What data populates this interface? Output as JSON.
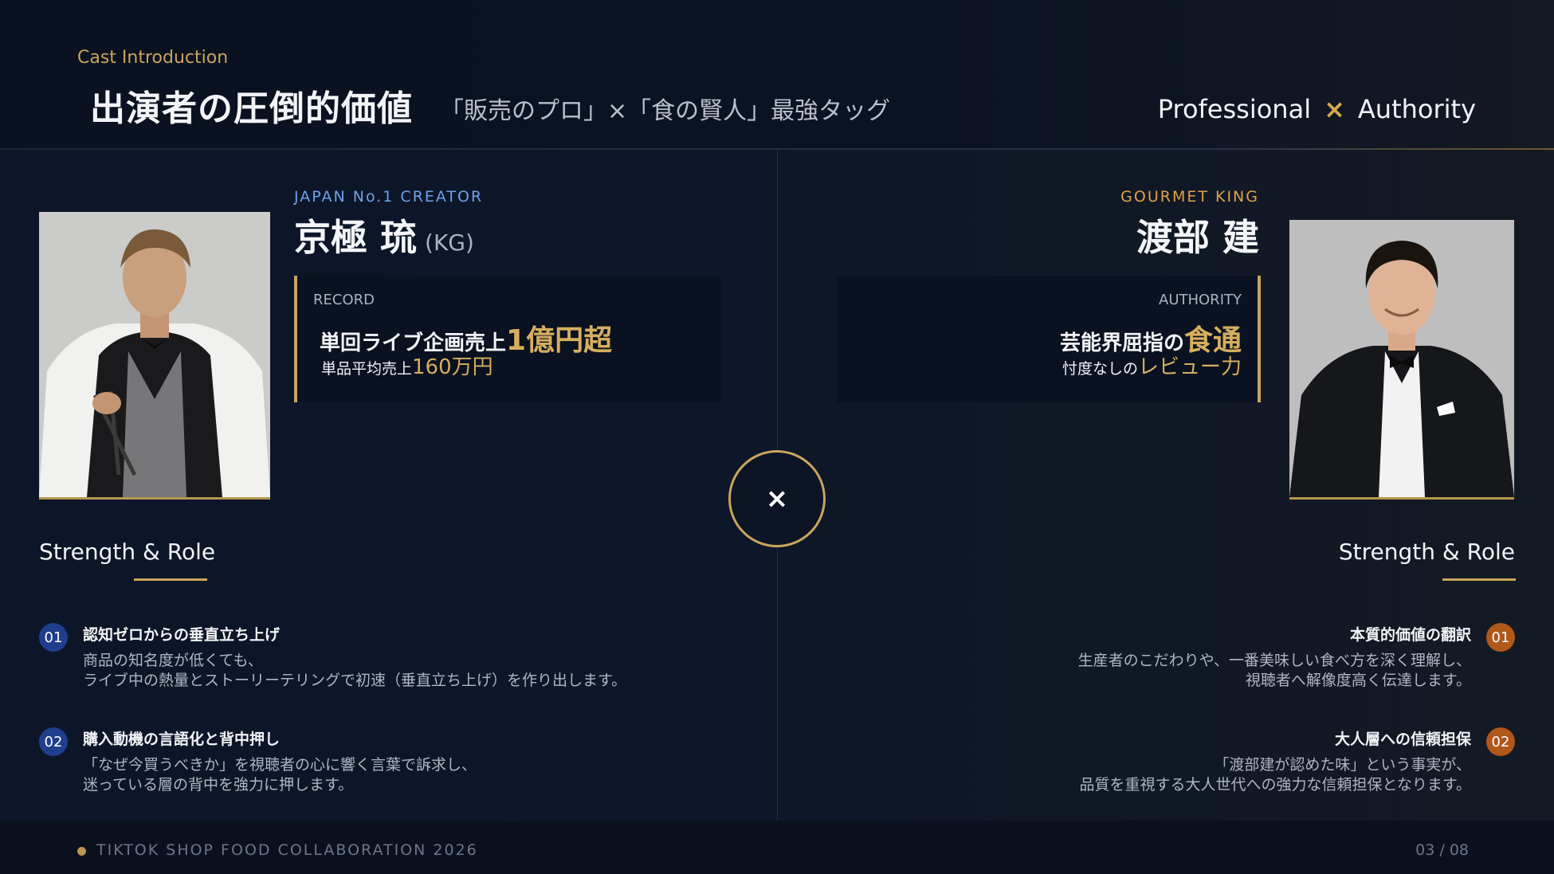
{
  "header": {
    "eyebrow": "Cast Introduction",
    "title": "出演者の圧倒的価値",
    "subtitle": "「販売のプロ」×「食の賢人」最強タッグ",
    "tagline_left": "Professional",
    "tagline_x": "×",
    "tagline_right": "Authority"
  },
  "left": {
    "tag": "JAPAN No.1 CREATOR",
    "name": "京極 琉",
    "name_suffix": "(KG)",
    "record_head": "RECORD",
    "record_line1_prefix": "単回ライブ企画売上",
    "record_line1_highlight": "1億円超",
    "record_line2_prefix": "単品平均売上",
    "record_line2_highlight": "160万円",
    "strength_title": "Strength & Role",
    "items": [
      {
        "num": "01",
        "title": "認知ゼロからの垂直立ち上げ",
        "desc1": "商品の知名度が低くても、",
        "desc2": "ライブ中の熱量とストーリーテリングで初速（垂直立ち上げ）を作り出します。"
      },
      {
        "num": "02",
        "title": "購入動機の言語化と背中押し",
        "desc1": "「なぜ今買うべきか」を視聴者の心に響く言葉で訴求し、",
        "desc2": "迷っている層の背中を強力に押します。"
      }
    ]
  },
  "right": {
    "tag": "GOURMET KING",
    "name": "渡部 建",
    "record_head": "AUTHORITY",
    "record_line1_prefix": "芸能界屈指の",
    "record_line1_highlight": "食通",
    "record_line2_prefix": "忖度なしの",
    "record_line2_highlight": "レビュー力",
    "strength_title": "Strength & Role",
    "items": [
      {
        "num": "01",
        "title": "本質的価値の翻訳",
        "desc1": "生産者のこだわりや、一番美味しい食べ方を深く理解し、",
        "desc2": "視聴者へ解像度高く伝達します。"
      },
      {
        "num": "02",
        "title": "大人層への信頼担保",
        "desc1": "「渡部建が認めた味」という事実が、",
        "desc2": "品質を重視する大人世代への強力な信頼担保となります。"
      }
    ]
  },
  "center": {
    "vs_symbol": "×"
  },
  "footer": {
    "text": "TIKTOK SHOP FOOD COLLABORATION 2026",
    "page": "03 / 08"
  },
  "colors": {
    "accent_gold": "#c9a55c",
    "left_tag": "#6ea0e8",
    "right_tag": "#e0a24a"
  }
}
